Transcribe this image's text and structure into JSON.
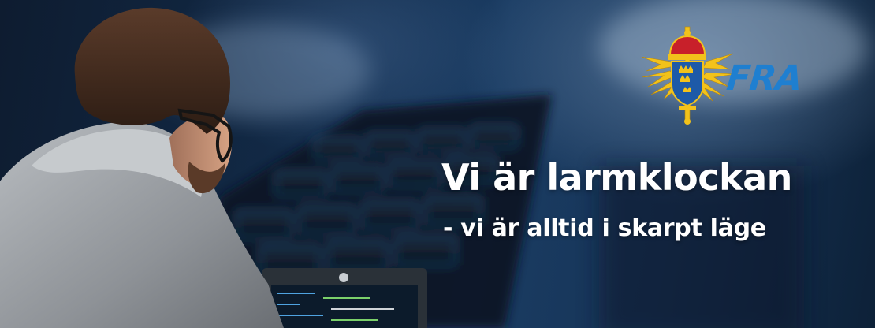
{
  "banner": {
    "headline": "Vi är larmklockan",
    "subline": "- vi är alltid i skarpt läge"
  },
  "logo": {
    "text": "FRA",
    "icon": "swedish-crown-lightning-emblem-icon",
    "colors": {
      "text": "#1f7fd0",
      "gold": "#f2c21b",
      "crown_red": "#c8202a",
      "shield_blue": "#1d5aa8"
    }
  },
  "photo": {
    "subject_icon": "person-at-laptop-icon",
    "background_icon": "keyboard-icon"
  }
}
